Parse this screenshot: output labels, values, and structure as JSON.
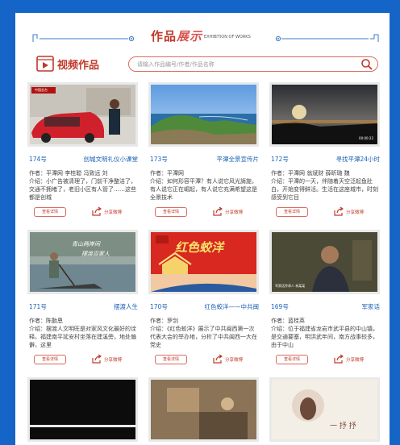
{
  "header": {
    "title_a": "作品",
    "title_b": "展示",
    "title_c": "示",
    "subtitle": "EXHIBITION OF WORKS"
  },
  "section": {
    "label": "视频作品",
    "search_placeholder": "请输入作品编号/作者/作品名称"
  },
  "colors": {
    "background": "#1565c8",
    "accent": "#c0392b",
    "meta_blue": "#1a5fb4"
  },
  "buttons": {
    "detail": "查看详情",
    "share": "分享微博"
  },
  "cards": [
    {
      "no": "174号",
      "title": "创城文明礼仪小课堂",
      "author": "作者：平潭网 李桂聪 冯致远 刘",
      "intro": "介绍：小广告被清理了，门前干净整洁了，交通不拥堵了，老旧小区有人管了……这些都是创城",
      "badge": "中国总台"
    },
    {
      "no": "173号",
      "title": "平潭全景宣传片",
      "author": "作者：平潭网",
      "intro": "介绍：如何形容平潭？有人说它风光旖旎，有人说它正在崛起，有人说它充满希望这是全景技术"
    },
    {
      "no": "172号",
      "title": "寻找平潭24小时",
      "author": "作者：平潭网 翁斌财 薛昕璐 魏",
      "intro": "介绍：平潭的一天，伴随着天空泛起鱼肚白，开始变得鲜活。生活在这座城市，时刻感受到它目",
      "timestamp": "00:00:22"
    },
    {
      "no": "171号",
      "title": "摆渡人生",
      "author": "作者：陈勤恩",
      "intro": "介绍：摆渡人文明旺是对家风文化最好的诠释。福建南平延安村坐落在建溪旁，地处偏僻，这里",
      "caption_1": "青山两岸间",
      "caption_2": "摆渡百家人"
    },
    {
      "no": "170号",
      "title": "红色蛟洋——中共闽",
      "author": "作者：罗剑",
      "intro": "介绍：《红色蛟洋》展示了中共闽西第一次代表大会的举办地，分析了中共闽西一大在党史",
      "banner": "红色蛟洋"
    },
    {
      "no": "169号",
      "title": "军家话",
      "author": "作者：蓝桂英",
      "intro": "介绍：位于福建省龙岩市武平县的中山镇，是交通要塞，明洪武年间，南方战事较多，由于中山",
      "caption": "军家话传承人 林某某"
    },
    {
      "no": "",
      "title": ""
    },
    {
      "no": "",
      "title": ""
    },
    {
      "no": "",
      "title": "",
      "calligraphy": "一 抒 抒"
    }
  ]
}
